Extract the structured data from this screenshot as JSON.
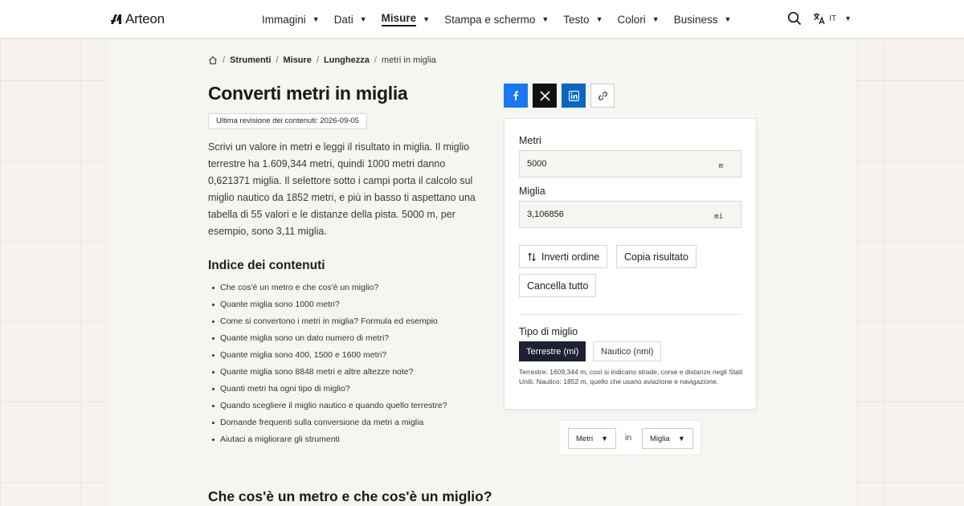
{
  "brand": {
    "name": "Arteon"
  },
  "nav": {
    "items": [
      {
        "label": "Immagini",
        "active": false
      },
      {
        "label": "Dati",
        "active": false
      },
      {
        "label": "Misure",
        "active": true
      },
      {
        "label": "Stampa e schermo",
        "active": false
      },
      {
        "label": "Testo",
        "active": false
      },
      {
        "label": "Colori",
        "active": false
      },
      {
        "label": "Business",
        "active": false
      }
    ],
    "language": "IT"
  },
  "breadcrumb": [
    "Strumenti",
    "Misure",
    "Lunghezza",
    "metri in miglia"
  ],
  "page": {
    "title": "Converti metri in miglia",
    "revision": "Ultima revisione dei contenuti: 2026-09-05",
    "intro": "Scrivi un valore in metri e leggi il risultato in miglia. Il miglio terrestre ha 1.609,344 metri, quindi 1000 metri danno 0,621371 miglia. Il selettore sotto i campi porta il calcolo sul miglio nautico da 1852 metri, e più in basso ti aspettano una tabella di 55 valori e le distanze della pista. 5000 m, per esempio, sono 3,11 miglia."
  },
  "toc": {
    "title": "Indice dei contenuti",
    "items": [
      "Che cos'è un metro e che cos'è un miglio?",
      "Quante miglia sono 1000 metri?",
      "Come si convertono i metri in miglia? Formula ed esempio",
      "Quante miglia sono un dato numero di metri?",
      "Quante miglia sono 400, 1500 e 1600 metri?",
      "Quante miglia sono 8848 metri e altre altezze note?",
      "Quanti metri ha ogni tipo di miglio?",
      "Quando scegliere il miglio nautico e quando quello terrestre?",
      "Domande frequenti sulla conversione da metri a miglia",
      "Aiutaci a migliorare gli strumenti"
    ]
  },
  "next_section_title": "Che cos'è un metro e che cos'è un miglio?",
  "converter": {
    "input_label": "Metri",
    "input_value": "5000",
    "input_unit": "m",
    "output_label": "Miglia",
    "output_value": "3,106856",
    "output_unit": "mi",
    "swap_label": "Inverti ordine",
    "copy_label": "Copia risultato",
    "clear_label": "Cancella tutto",
    "mile_type_label": "Tipo di miglio",
    "mile_options": [
      "Terrestre (mi)",
      "Nautico (nmi)"
    ],
    "hint": "Terrestre: 1609,344 m, così si indicano strade, corse e distanze negli Stati Uniti. Nautico: 1852 m, quello che usano aviazione e navigazione."
  },
  "units_row": {
    "from": "Metri",
    "in_label": "in",
    "to": "Miglia"
  },
  "colors": {
    "accent_dark": "#1d2033",
    "facebook": "#1877f2",
    "linkedin": "#0a66c2",
    "x": "#111111"
  }
}
